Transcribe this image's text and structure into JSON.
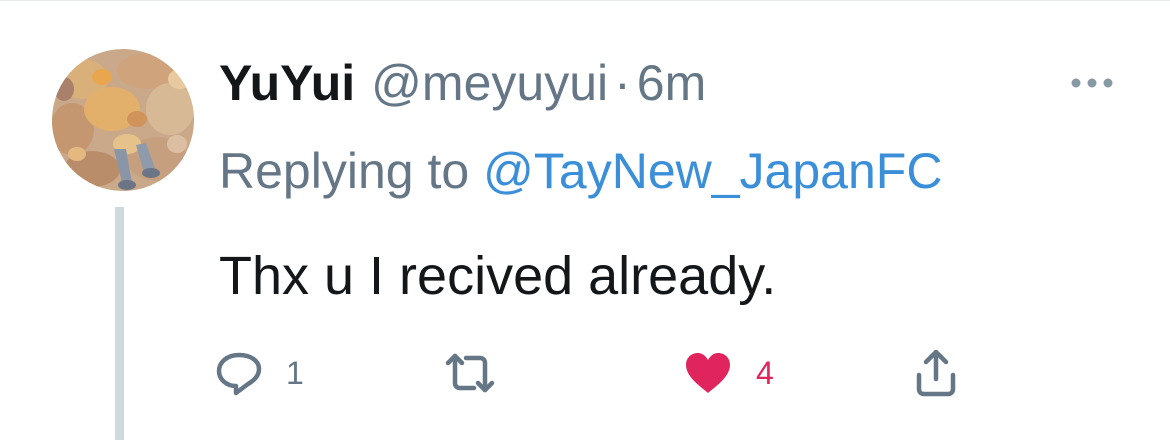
{
  "tweet": {
    "display_name": "YuYui",
    "handle": "@meyuyui",
    "separator": "·",
    "time": "6m",
    "replying_prefix": "Replying to",
    "replying_to": "@TayNew_JapanFC",
    "text": "Thx u I recived already."
  },
  "actions": {
    "reply_count": "1",
    "retweet_count": "",
    "like_count": "4",
    "liked": true
  },
  "icons": {
    "reply": "reply-icon",
    "retweet": "retweet-icon",
    "like": "heart-icon",
    "share": "share-icon",
    "more": "more-icon"
  },
  "colors": {
    "text": "#14171a",
    "secondary": "#657786",
    "link": "#3b8fd9",
    "like": "#e0245e",
    "thread_line": "#cfd9de"
  }
}
